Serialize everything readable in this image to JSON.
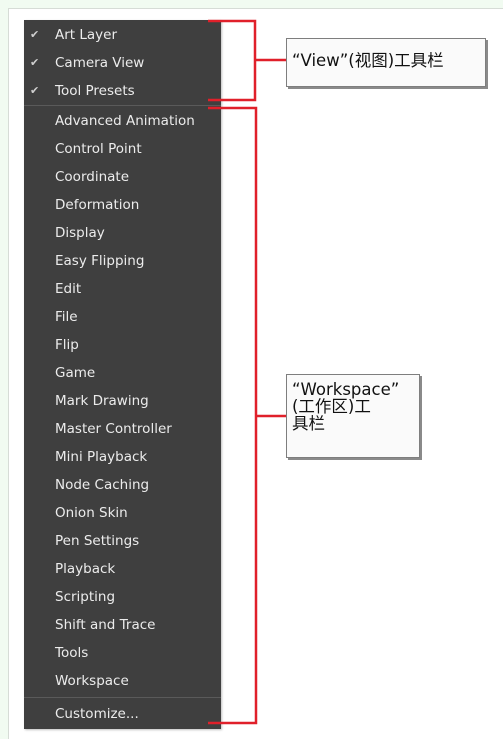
{
  "menu": {
    "checked_items": [
      {
        "label": "Art Layer",
        "checked": true
      },
      {
        "label": "Camera View",
        "checked": true
      },
      {
        "label": "Tool Presets",
        "checked": true
      }
    ],
    "items": [
      {
        "label": "Advanced Animation"
      },
      {
        "label": "Control Point"
      },
      {
        "label": "Coordinate"
      },
      {
        "label": "Deformation"
      },
      {
        "label": "Display"
      },
      {
        "label": "Easy Flipping"
      },
      {
        "label": "Edit"
      },
      {
        "label": "File"
      },
      {
        "label": "Flip"
      },
      {
        "label": "Game"
      },
      {
        "label": "Mark Drawing"
      },
      {
        "label": "Master Controller"
      },
      {
        "label": "Mini Playback"
      },
      {
        "label": "Node Caching"
      },
      {
        "label": "Onion Skin"
      },
      {
        "label": "Pen Settings"
      },
      {
        "label": "Playback"
      },
      {
        "label": "Scripting"
      },
      {
        "label": "Shift and Trace"
      },
      {
        "label": "Tools"
      },
      {
        "label": "Workspace"
      }
    ],
    "customize_label": "Customize...",
    "check_glyph": "✔"
  },
  "callouts": {
    "view_toolbar": "“View”(视图)工具栏",
    "workspace_toolbar_line1": "“Workspace”",
    "workspace_toolbar_line2": "(工作区)工",
    "workspace_toolbar_line3": "具栏"
  },
  "colors": {
    "menu_bg": "#3f3f3f",
    "menu_text": "#ececec",
    "bracket": "#e0202a",
    "page_bg": "#f1fbf1"
  }
}
